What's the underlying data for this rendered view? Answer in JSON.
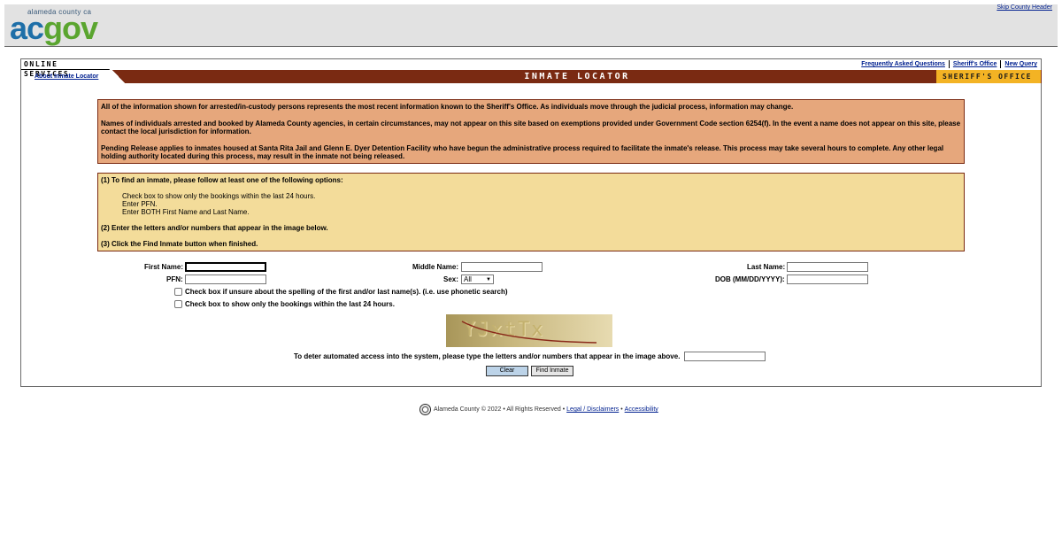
{
  "header": {
    "logo_small": "alameda county ca",
    "logo_ac": "ac",
    "logo_gov": "gov",
    "skip_link": "Skip County Header"
  },
  "nav": {
    "online_services": "ONLINE SERVICES",
    "about_link": "About Inmate Locator",
    "faq_link": "Frequently Asked Questions",
    "sheriff_link": "Sheriff's Office",
    "new_query_link": "New Query",
    "title": "INMATE LOCATOR",
    "sheriff_badge": "SHERIFF'S OFFICE"
  },
  "notice": {
    "p1": "All of the information shown for arrested/in-custody persons represents the most recent information known to the Sheriff's Office.  As individuals move through the judicial process, information may change.",
    "p2": "Names of individuals arrested and booked by Alameda County agencies, in certain circumstances, may not appear on this site based on exemptions provided under Government Code section 6254(f).  In the event a name does not appear on this site, please contact the local jurisdiction for information.",
    "p3": "Pending Release applies to inmates housed at Santa Rita Jail and Glenn E. Dyer Detention Facility who have begun the administrative process required to facilitate the inmate's release.  This process may take several hours to complete.  Any other legal holding authority located during this process, may result in the inmate not being released."
  },
  "instructions": {
    "step1": "(1) To find an inmate, please follow at least one of the following options:",
    "options": [
      "Check box to show only the bookings within the last 24 hours.",
      "Enter PFN.",
      "Enter BOTH First Name and Last Name."
    ],
    "step2": "(2) Enter the letters and/or numbers that appear in the image below.",
    "step3": "(3) Click the Find Inmate button when finished."
  },
  "form": {
    "first_name_label": "First Name:",
    "first_name_value": "",
    "middle_name_label": "Middle Name:",
    "middle_name_value": "",
    "last_name_label": "Last Name:",
    "last_name_value": "",
    "pfn_label": "PFN:",
    "pfn_value": "",
    "sex_label": "Sex:",
    "sex_selected": "All",
    "dob_label": "DOB (MM/DD/YYYY):",
    "dob_value": "",
    "phonetic_label": "Check box if unsure about the spelling of the first and/or last name(s). (i.e. use phonetic search)",
    "last24_label": "Check box to show only the bookings within the last 24 hours.",
    "captcha_text": "YJxtTx",
    "captcha_prompt": "To deter automated access into the system, please type the letters and/or numbers that appear in the image above.",
    "captcha_value": "",
    "clear_button": "Clear",
    "find_button": "Find Inmate"
  },
  "footer": {
    "copyright": "Alameda County © 2022 • All Rights Reserved •",
    "legal_link": "Legal / Disclaimers",
    "sep": "•",
    "accessibility_link": "Accessibility"
  },
  "colors": {
    "title_bar": "#7a2a12",
    "notice_bg": "#e6a77c",
    "instructions_bg": "#f3dc9a",
    "sheriff_badge": "#f3b324",
    "link": "#00208f"
  }
}
